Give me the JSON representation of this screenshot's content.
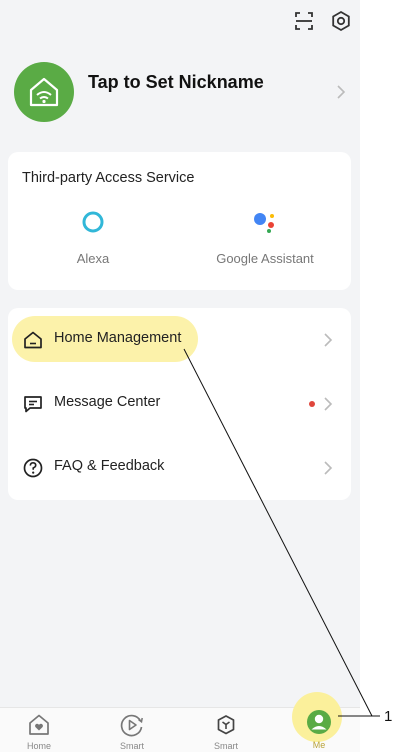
{
  "profile": {
    "nickname": "Tap to Set Nickname"
  },
  "third_party": {
    "title": "Third-party Access Service",
    "services": [
      {
        "label": "Alexa",
        "icon": "alexa-icon"
      },
      {
        "label": "Google Assistant",
        "icon": "google-assistant-icon"
      }
    ]
  },
  "menu": [
    {
      "label": "Home Management",
      "icon": "home-icon",
      "highlighted": true
    },
    {
      "label": "Message Center",
      "icon": "message-icon",
      "has_badge": true
    },
    {
      "label": "FAQ & Feedback",
      "icon": "question-icon"
    }
  ],
  "tabs": [
    {
      "label": "Home",
      "icon": "home-heart-icon"
    },
    {
      "label": "Smart",
      "icon": "play-circle-icon"
    },
    {
      "label": "Smart",
      "icon": "cube-icon"
    },
    {
      "label": "Me",
      "icon": "user-icon",
      "active": true
    }
  ],
  "callout": {
    "number": "1"
  },
  "colors": {
    "accent": "#5aab45",
    "highlight": "#fbf09b",
    "badge": "#e0463c"
  }
}
